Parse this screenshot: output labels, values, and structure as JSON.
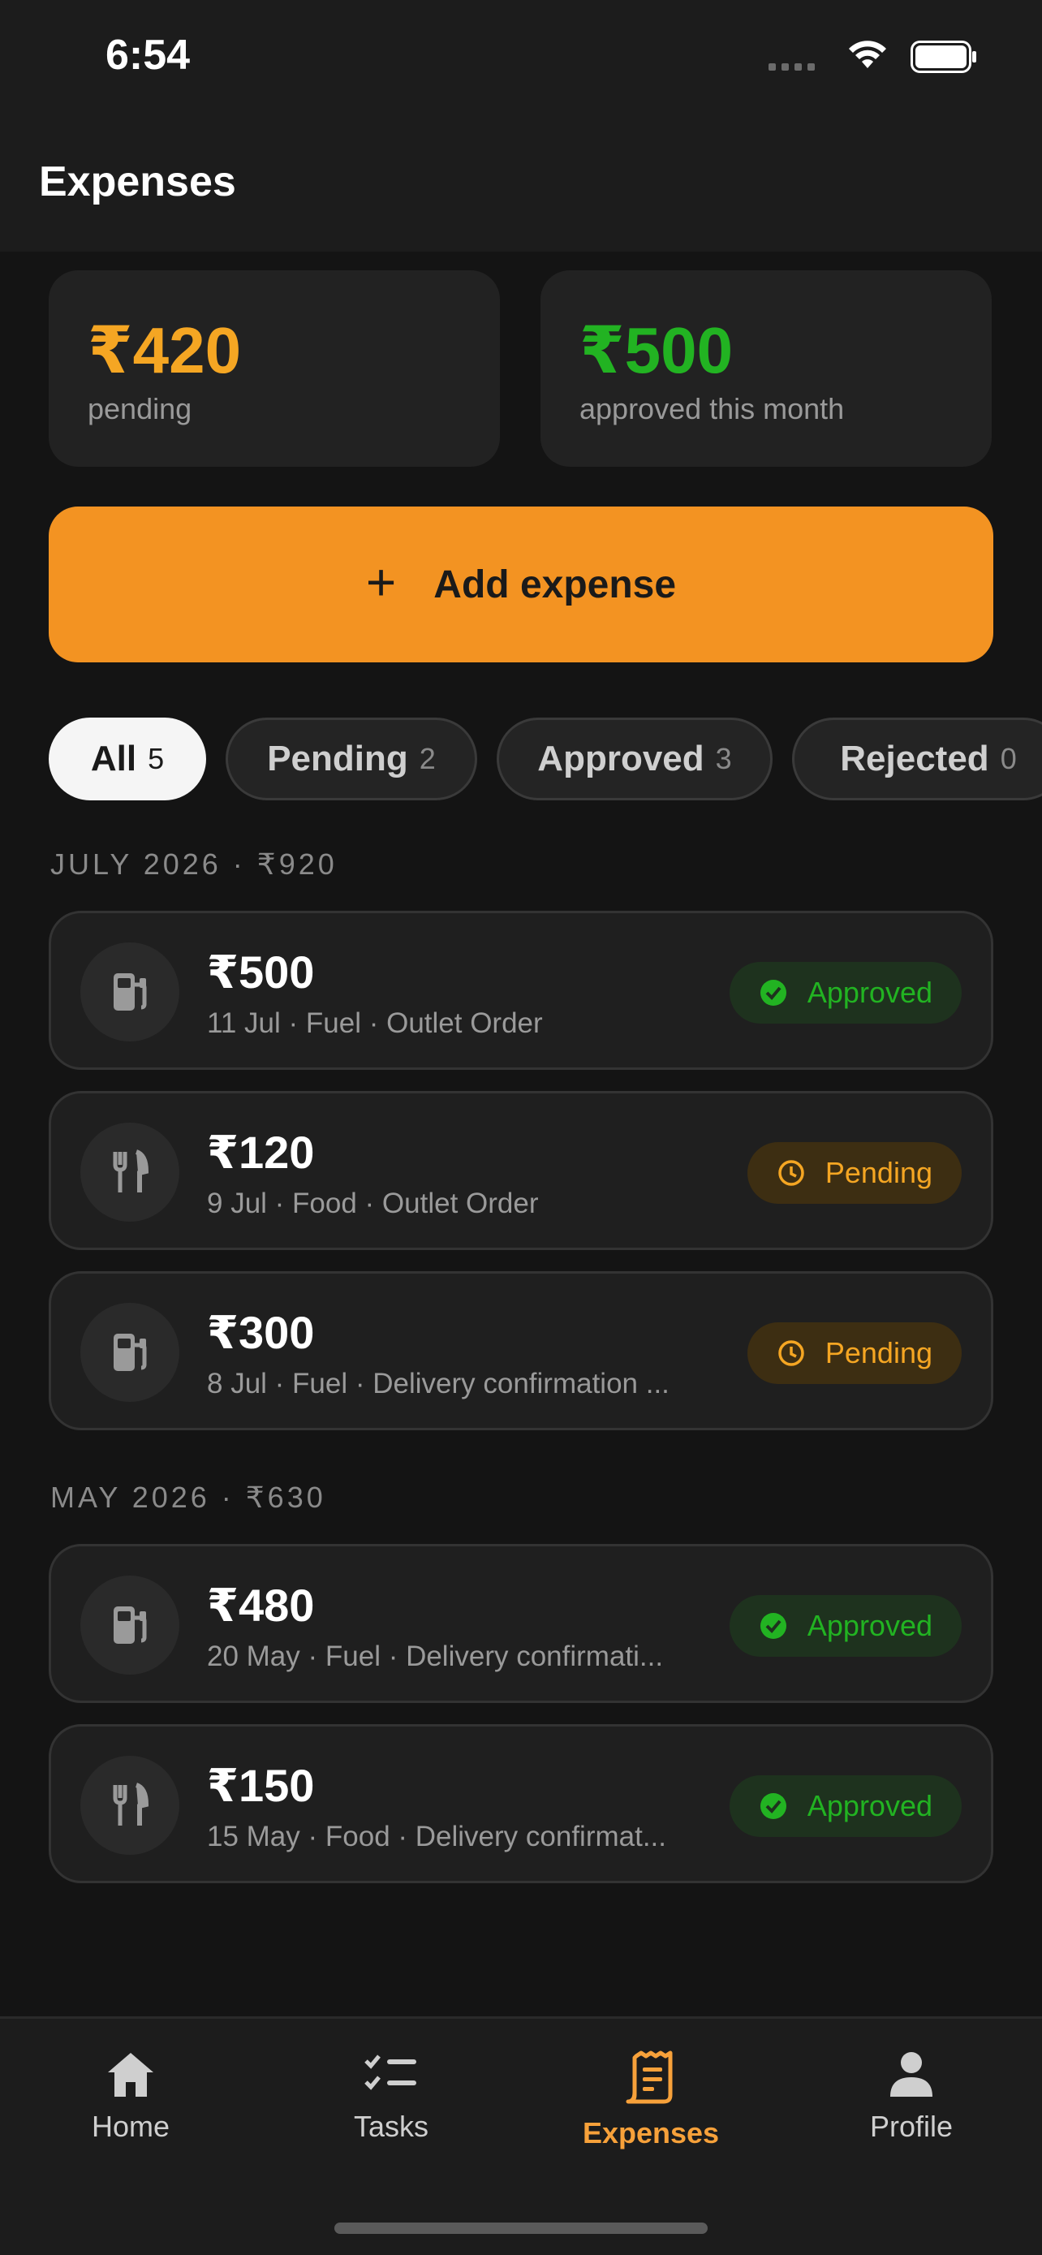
{
  "status_bar": {
    "time": "6:54"
  },
  "header": {
    "title": "Expenses"
  },
  "summary": {
    "pending": {
      "amount": "₹420",
      "label": "pending",
      "color": "#f5a623"
    },
    "approved": {
      "amount": "₹500",
      "label": "approved this month",
      "color": "#22b322"
    }
  },
  "add_button": {
    "label": "Add expense",
    "icon": "plus-icon",
    "color": "#f39322"
  },
  "filters": [
    {
      "label": "All",
      "count": "5",
      "active": true
    },
    {
      "label": "Pending",
      "count": "2",
      "active": false
    },
    {
      "label": "Approved",
      "count": "3",
      "active": false
    },
    {
      "label": "Rejected",
      "count": "0",
      "active": false
    }
  ],
  "groups": [
    {
      "header": "JULY 2026 · ₹920",
      "items": [
        {
          "icon": "fuel-icon",
          "amount": "₹500",
          "meta": "11 Jul · Fuel · Outlet Order",
          "status": "Approved"
        },
        {
          "icon": "food-icon",
          "amount": "₹120",
          "meta": "9 Jul · Food · Outlet Order",
          "status": "Pending"
        },
        {
          "icon": "fuel-icon",
          "amount": "₹300",
          "meta": "8 Jul · Fuel · Delivery confirmation ...",
          "status": "Pending"
        }
      ]
    },
    {
      "header": "MAY 2026 · ₹630",
      "items": [
        {
          "icon": "fuel-icon",
          "amount": "₹480",
          "meta": "20 May · Fuel · Delivery confirmati...",
          "status": "Approved"
        },
        {
          "icon": "food-icon",
          "amount": "₹150",
          "meta": "15 May · Food · Delivery confirmat...",
          "status": "Approved"
        }
      ]
    }
  ],
  "nav": [
    {
      "label": "Home",
      "icon": "home-icon",
      "active": false
    },
    {
      "label": "Tasks",
      "icon": "tasks-icon",
      "active": false
    },
    {
      "label": "Expenses",
      "icon": "receipt-icon",
      "active": true
    },
    {
      "label": "Profile",
      "icon": "profile-icon",
      "active": false
    }
  ],
  "colors": {
    "accent": "#f39322",
    "approved": "#22b322",
    "pending": "#f5a623",
    "background": "#141414"
  }
}
